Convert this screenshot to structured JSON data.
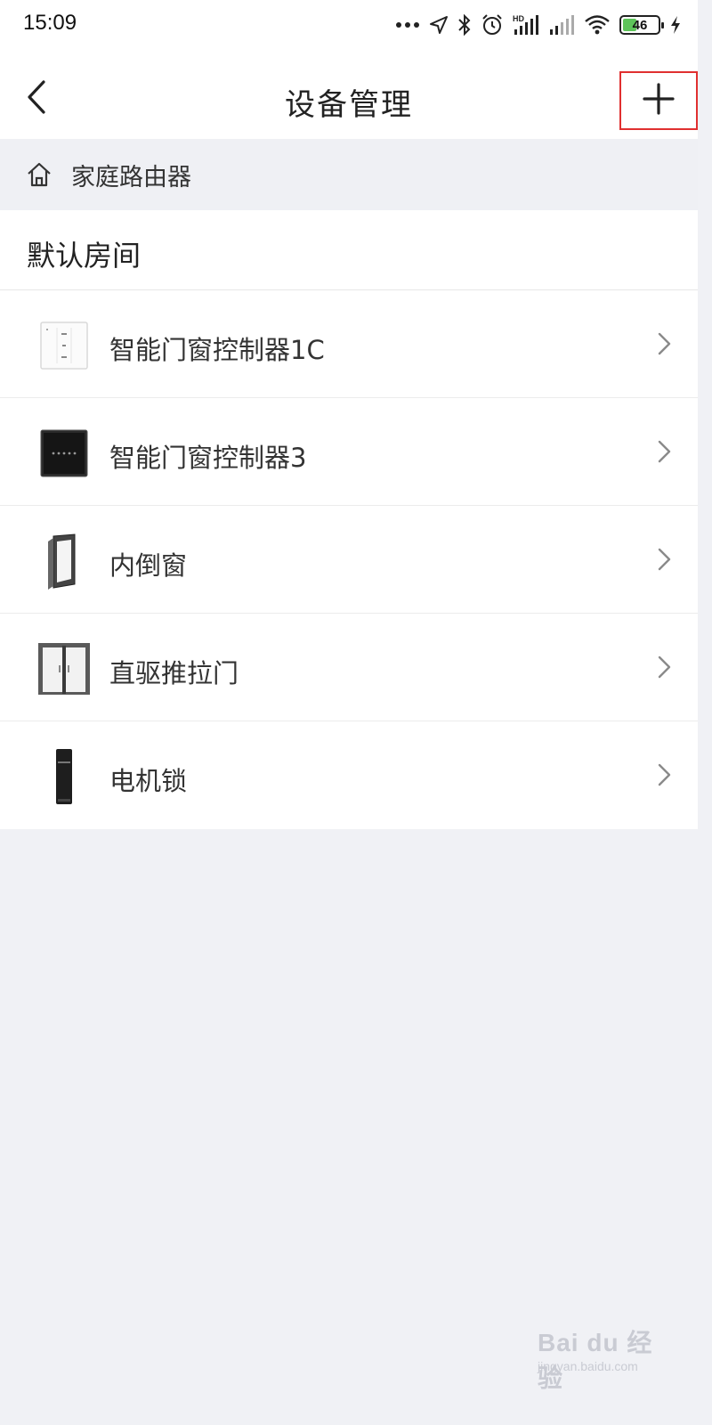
{
  "status_bar": {
    "time": "15:09",
    "battery_level": "46",
    "icons": [
      "more-dots-icon",
      "location-arrow-icon",
      "bluetooth-icon",
      "alarm-icon",
      "hd-signal-icon",
      "signal-icon",
      "wifi-icon",
      "battery-icon",
      "charging-icon"
    ]
  },
  "nav": {
    "back_icon": "chevron-left-icon",
    "title": "设备管理",
    "add_icon": "plus-icon",
    "add_highlight_color": "#e03030"
  },
  "home": {
    "icon": "home-icon",
    "name": "家庭路由器"
  },
  "room": {
    "title": "默认房间"
  },
  "devices": [
    {
      "name": "智能门窗控制器1C",
      "icon": "wall-switch-icon"
    },
    {
      "name": "智能门窗控制器3",
      "icon": "touch-panel-icon"
    },
    {
      "name": "内倒窗",
      "icon": "tilt-window-icon"
    },
    {
      "name": "直驱推拉门",
      "icon": "sliding-door-icon"
    },
    {
      "name": "电机锁",
      "icon": "motor-lock-icon"
    }
  ],
  "watermark": {
    "main": "Bai du 经验",
    "sub": "jingyan.baidu.com"
  },
  "colors": {
    "background": "#f0f1f5",
    "surface": "#ffffff",
    "battery_fill": "#5ec45a"
  }
}
